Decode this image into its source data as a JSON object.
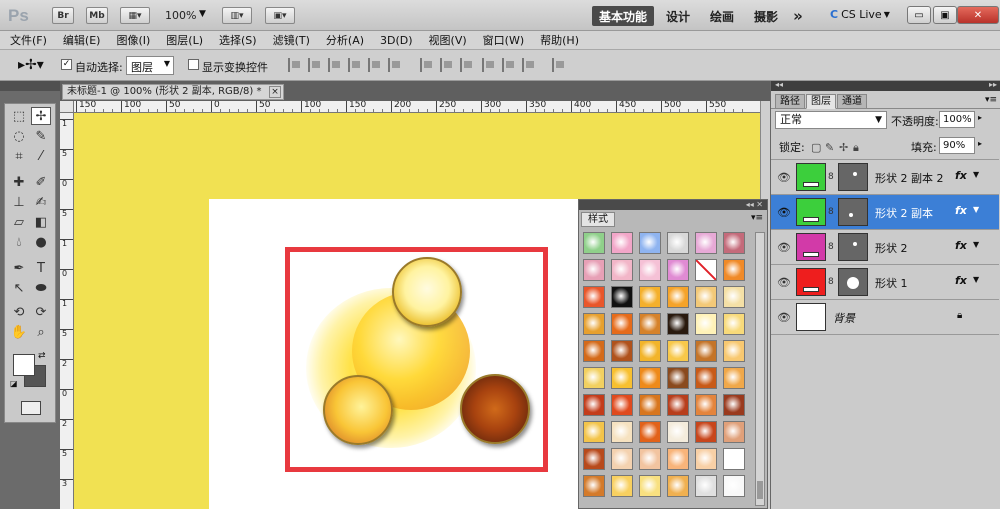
{
  "titlebar": {
    "logo": "Ps",
    "bridge": "Br",
    "minibridge": "Mb",
    "zoom": "100%",
    "workspaces": [
      "基本功能",
      "设计",
      "绘画",
      "摄影"
    ],
    "more": "»",
    "cslive": "CS Live"
  },
  "menu": [
    "文件(F)",
    "编辑(E)",
    "图像(I)",
    "图层(L)",
    "选择(S)",
    "滤镜(T)",
    "分析(A)",
    "3D(D)",
    "视图(V)",
    "窗口(W)",
    "帮助(H)"
  ],
  "options": {
    "auto_select_label": "自动选择:",
    "auto_select_checked": true,
    "auto_select_value": "图层",
    "transform_label": "显示变换控件",
    "transform_checked": false
  },
  "document": {
    "tab_title": "未标题-1 @ 100% (形状 2 副本, RGB/8) *",
    "close": "×",
    "ruler_h": [
      "150",
      "100",
      "50",
      "0",
      "50",
      "100",
      "150",
      "200",
      "250",
      "300",
      "350",
      "400",
      "450",
      "500",
      "550"
    ],
    "ruler_v": [
      "1",
      "5",
      "0",
      "5",
      "1",
      "0",
      "1",
      "5",
      "2",
      "0",
      "2",
      "5",
      "3"
    ]
  },
  "styles_panel": {
    "tab": "样式",
    "swatches": [
      [
        "#8fd08a",
        "#f2a6c8",
        "#8fb4f0",
        "#d8d8d8",
        "#e7a9d6",
        "#c46a7a"
      ],
      [
        "#e7a0b6",
        "#f2b6c8",
        "#f5c1d6",
        "#e08bd3",
        "#ffffff",
        "#f08a28"
      ],
      [
        "#e9562a",
        "#111111",
        "#f4b02c",
        "#f5a32a",
        "#f3c978",
        "#f4e0a6"
      ],
      [
        "#e7a02e",
        "#e66b1a",
        "#d6822a",
        "#2a1a0e",
        "#fff2b8",
        "#f8da7a"
      ],
      [
        "#d46a1a",
        "#b0521c",
        "#f2b42a",
        "#f8c84a",
        "#c47428",
        "#f8c870"
      ],
      [
        "#f2d060",
        "#f8c030",
        "#ee8a1a",
        "#8a4a1e",
        "#c85a18",
        "#f0a84a"
      ],
      [
        "#c43c1a",
        "#e04a1e",
        "#d8761e",
        "#b83e1c",
        "#e4843c",
        "#9a3a1e"
      ],
      [
        "#f3c44a",
        "#f6e2c0",
        "#e2621a",
        "#f4ecdc",
        "#c8461c",
        "#e0a07a"
      ],
      [
        "#b84a1c",
        "#f4d2b0",
        "#f2c4a0",
        "#f8b47a",
        "#f8d0a6",
        "#ffffff"
      ],
      [
        "#d47a2a",
        "#f8d060",
        "#f8e080",
        "#f0b050",
        "#e0e0e0",
        "#f8f8f8"
      ]
    ]
  },
  "layers_panel": {
    "tabs": [
      "路径",
      "图层",
      "通道"
    ],
    "blend_mode": "正常",
    "opacity_label": "不透明度:",
    "opacity": "100%",
    "lock_label": "锁定:",
    "fill_label": "填充:",
    "fill": "90%",
    "layers": [
      {
        "name": "形状 2 副本 2",
        "color": "#3ccf3c",
        "fx": "fx",
        "selected": false
      },
      {
        "name": "形状 2 副本",
        "color": "#3ccf3c",
        "fx": "fx",
        "selected": true
      },
      {
        "name": "形状 2",
        "color": "#d23aa8",
        "fx": "fx",
        "selected": false
      },
      {
        "name": "形状 1",
        "color": "#ee1e1e",
        "fx": "fx",
        "selected": false
      },
      {
        "name": "背景",
        "color": "#ffffff",
        "fx": "",
        "selected": false
      }
    ]
  },
  "colors": {
    "pasteboard": "#f1e152",
    "selection": "#3c7fd6",
    "frame": "#e8393f"
  }
}
